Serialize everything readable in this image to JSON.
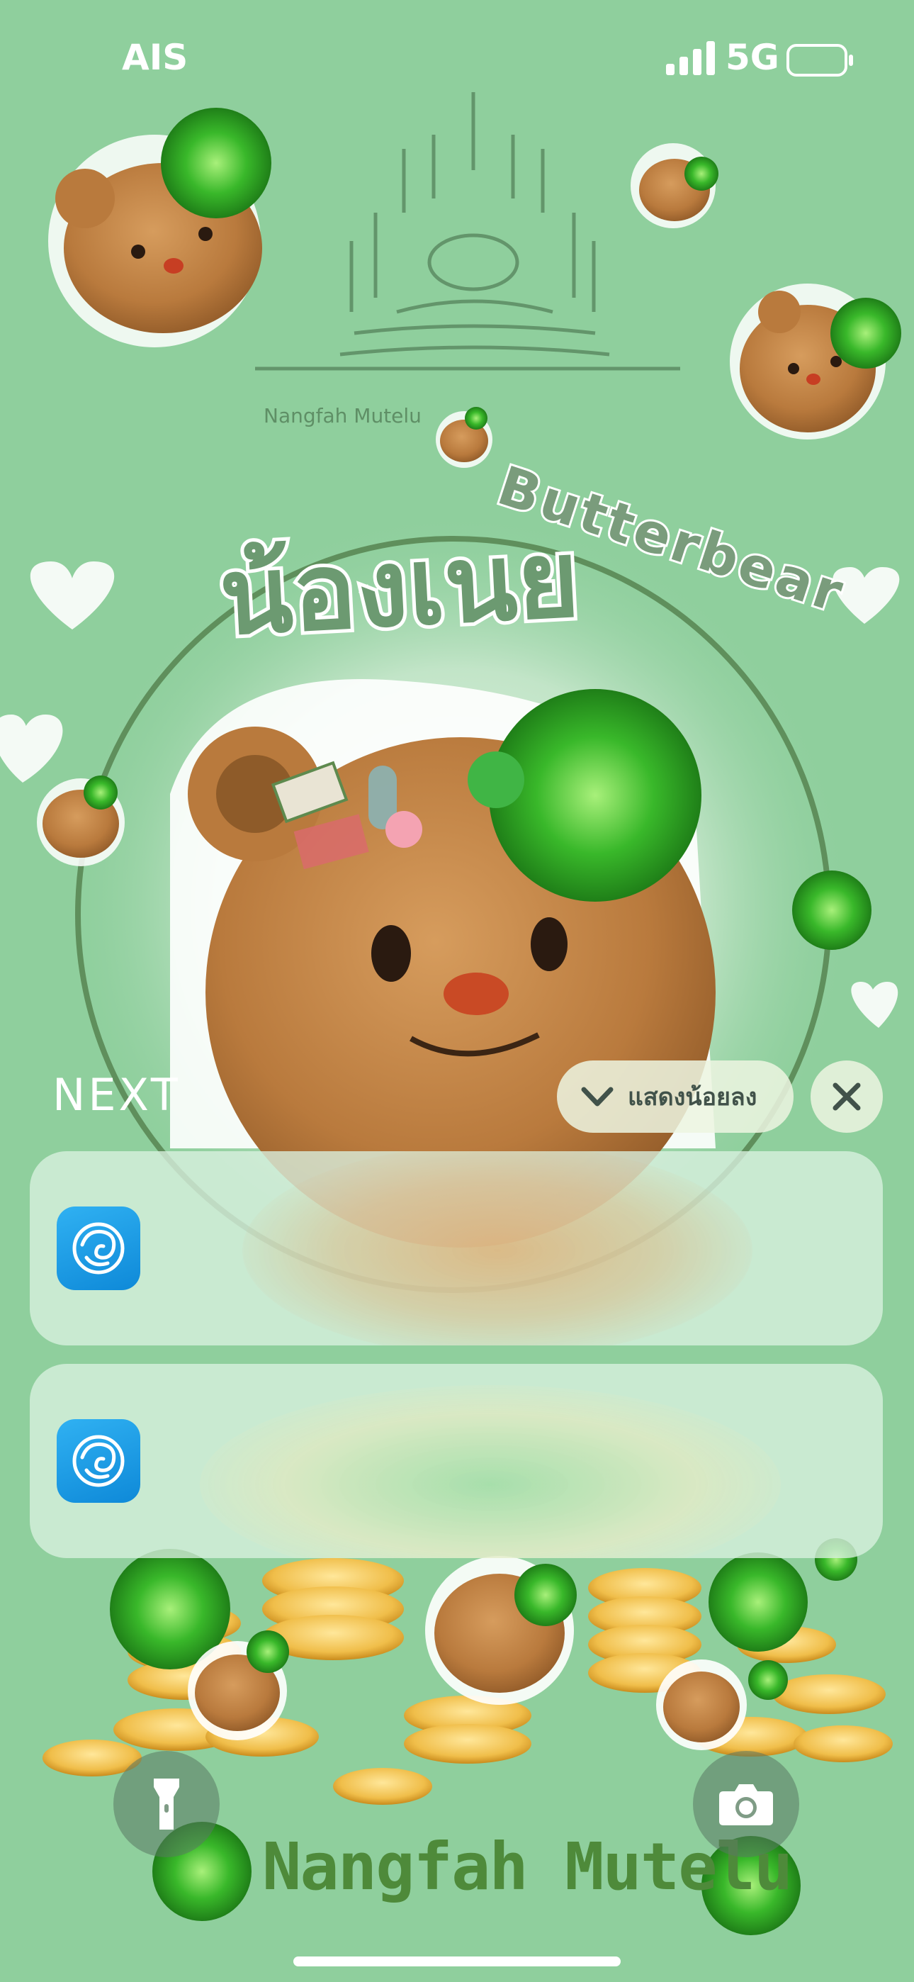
{
  "status_bar": {
    "carrier": "AIS",
    "network": "5G",
    "signal_icon": "cellular-signal-icon",
    "battery_icon": "battery-icon"
  },
  "wallpaper": {
    "brand_text": "Nangfah Mutelu",
    "small_caption": "Nangfah Mutelu",
    "sticker_text": "Butterbear",
    "thai_title": "น้องเนย",
    "background_color": "#8fcf9d"
  },
  "notifications": {
    "section_label": "NEXT",
    "show_less_label": "แสดงน้อยลง",
    "show_less_icon": "chevron-down-icon",
    "clear_icon": "close-icon",
    "items": [
      {
        "app_icon": "krungthai-app-icon"
      },
      {
        "app_icon": "krungthai-app-icon"
      }
    ]
  },
  "quick_actions": {
    "left_icon": "flashlight-icon",
    "right_icon": "camera-icon"
  },
  "colors": {
    "accent_green": "#5f8f5c",
    "app_icon_blue": "#1a98e2",
    "text_dark": "#41524a"
  }
}
